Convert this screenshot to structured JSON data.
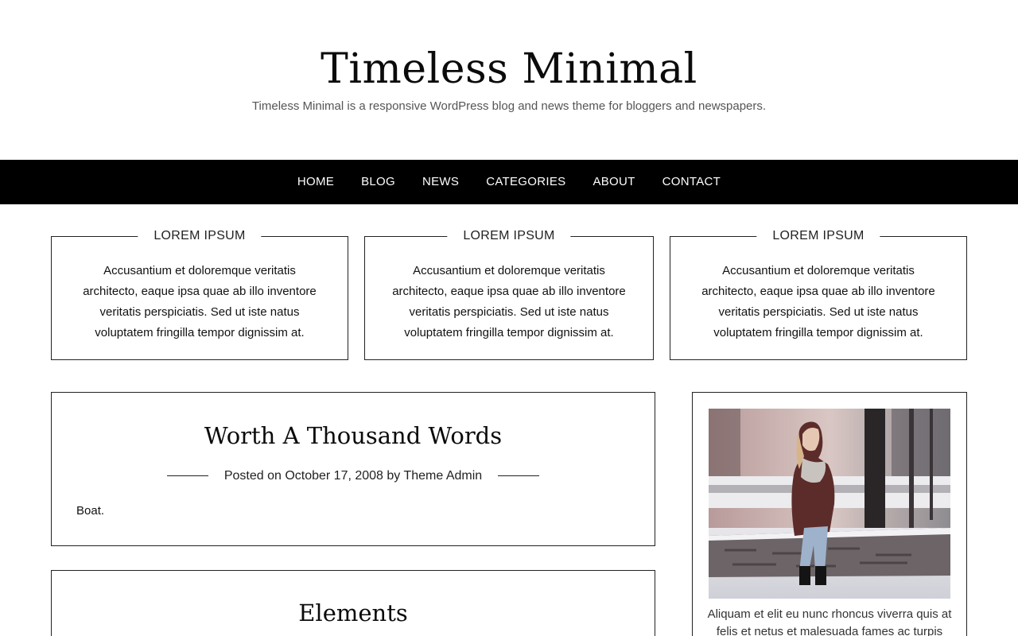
{
  "site": {
    "title": "Timeless Minimal",
    "description": "Timeless Minimal is a responsive WordPress blog and news theme for bloggers and newspapers."
  },
  "nav": {
    "items": [
      {
        "label": "HOME"
      },
      {
        "label": "BLOG"
      },
      {
        "label": "NEWS"
      },
      {
        "label": "CATEGORIES"
      },
      {
        "label": "ABOUT"
      },
      {
        "label": "CONTACT"
      }
    ]
  },
  "features": [
    {
      "title": "LOREM IPSUM",
      "text": "Accusantium et doloremque veritatis architecto, eaque ipsa quae ab illo inventore veritatis perspiciatis. Sed ut iste natus voluptatem fringilla tempor dignissim at."
    },
    {
      "title": "LOREM IPSUM",
      "text": "Accusantium et doloremque veritatis architecto, eaque ipsa quae ab illo inventore veritatis perspiciatis. Sed ut iste natus voluptatem fringilla tempor dignissim at."
    },
    {
      "title": "LOREM IPSUM",
      "text": "Accusantium et doloremque veritatis architecto, eaque ipsa quae ab illo inventore veritatis perspiciatis. Sed ut iste natus voluptatem fringilla tempor dignissim at."
    }
  ],
  "posts": [
    {
      "title": "Worth A Thousand Words",
      "meta_prefix": "Posted on ",
      "date": "October 17, 2008",
      "meta_by": " by ",
      "author": "Theme Admin",
      "excerpt": "Boat."
    },
    {
      "title": "Elements"
    }
  ],
  "sidebar": {
    "caption": "Aliquam et elit eu nunc rhoncus viverra quis at felis et netus et malesuada fames ac turpis egestas."
  }
}
